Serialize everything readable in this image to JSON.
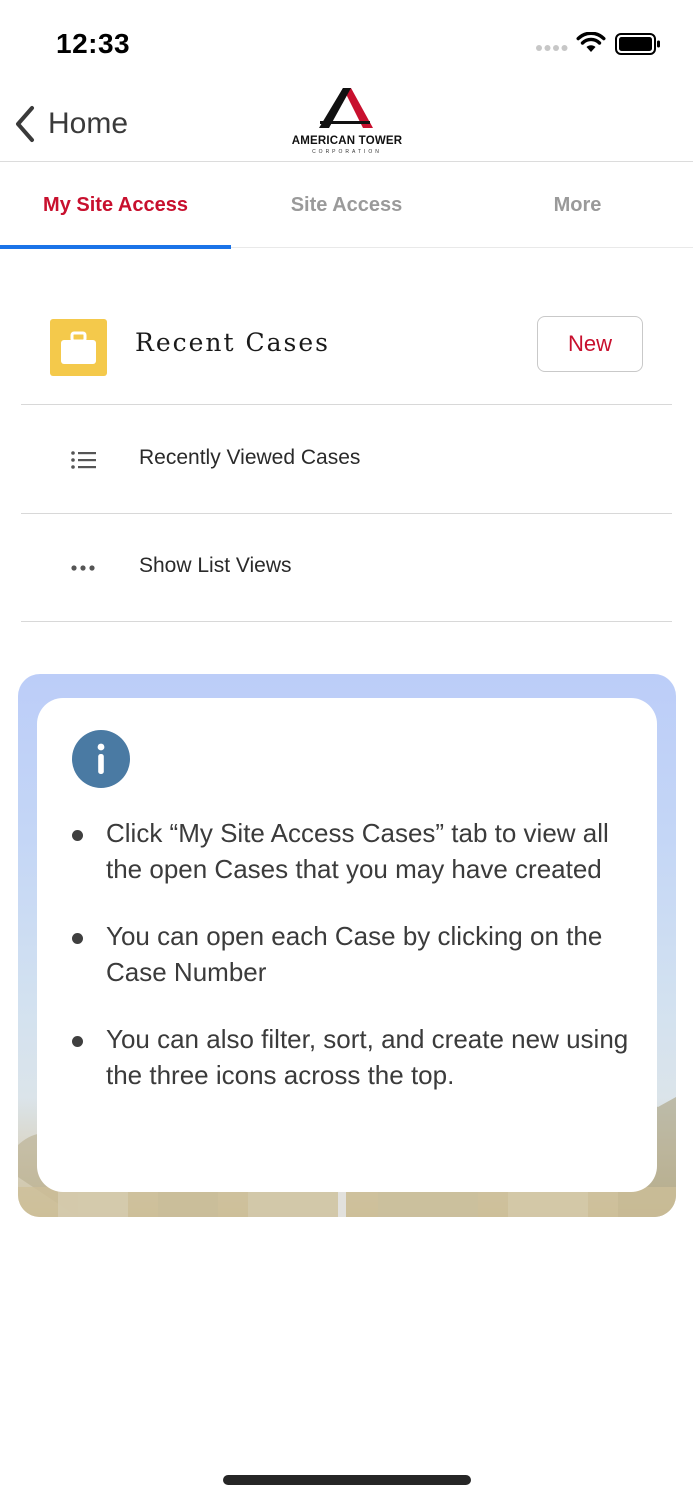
{
  "status_bar": {
    "time": "12:33"
  },
  "nav": {
    "back_label": "Home"
  },
  "brand": {
    "name": "AMERICAN TOWER",
    "sub": "CORPORATION",
    "colors": {
      "red": "#c8102e",
      "black": "#111111"
    }
  },
  "tabs": [
    {
      "label": "My Site Access",
      "active": true
    },
    {
      "label": "Site Access",
      "active": false
    },
    {
      "label": "More",
      "active": false
    }
  ],
  "cases": {
    "title": "Recent Cases",
    "icon": "briefcase-icon",
    "new_label": "New",
    "rows": [
      {
        "label": "Recently Viewed Cases",
        "icon": "list-icon"
      },
      {
        "label": "Show List Views",
        "icon": "more-dots-icon"
      }
    ]
  },
  "info": {
    "icon": "info-icon",
    "bullets": [
      "Click “My Site Access Cases” tab to view all the open Cases that you may have created",
      "You can open each Case by clicking on the Case Number",
      "You can also filter, sort, and create new using the three icons across the top."
    ]
  },
  "colors": {
    "accent": "#c8102e",
    "tab_indicator": "#1a73e8",
    "case_icon_bg": "#f4c94b",
    "info_icon_bg": "#4a7aa3"
  }
}
